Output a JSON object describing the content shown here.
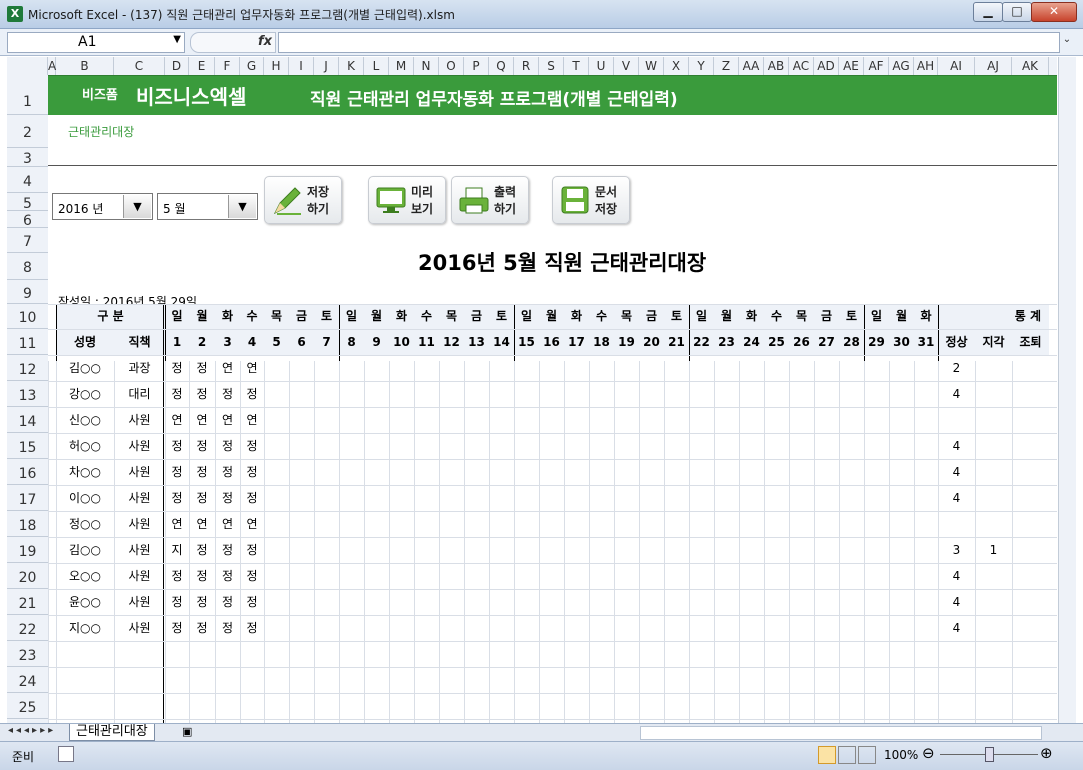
{
  "window": {
    "title": "Microsoft Excel - (137) 직원 근태관리 업무자동화 프로그램(개별 근태입력).xlsm",
    "app_icon": "X",
    "min": "▁",
    "max": "□",
    "close": "✕"
  },
  "formula": {
    "namebox": "A1",
    "fx": "fx",
    "value": ""
  },
  "columns": [
    "A",
    "B",
    "C",
    "D",
    "E",
    "F",
    "G",
    "H",
    "I",
    "J",
    "K",
    "L",
    "M",
    "N",
    "O",
    "P",
    "Q",
    "R",
    "S",
    "T",
    "U",
    "V",
    "W",
    "X",
    "Y",
    "Z",
    "AA",
    "AB",
    "AC",
    "AD",
    "AE",
    "AF",
    "AG",
    "AH",
    "AI",
    "AJ",
    "AK"
  ],
  "rows": [
    "1",
    "2",
    "3",
    "4",
    "5",
    "6",
    "7",
    "8",
    "9",
    "10",
    "11",
    "12",
    "13",
    "14",
    "15",
    "16",
    "17",
    "18",
    "19",
    "20",
    "21",
    "22",
    "23",
    "24",
    "25"
  ],
  "banner": {
    "brand_small": "비즈폼",
    "brand_big": "비즈니스엑셀",
    "title": "직원 근태관리 업무자동화 프로그램(개별 근태입력)"
  },
  "subtab": "근태관리대장",
  "controls": {
    "year": "2016 년",
    "month": "5 월",
    "save": [
      "저장",
      "하기"
    ],
    "preview": [
      "미리",
      "보기"
    ],
    "print": [
      "출력",
      "하기"
    ],
    "docsave": [
      "문서",
      "저장"
    ]
  },
  "report": {
    "title": "2016년 5월 직원 근태관리대장",
    "created": "작성일 :  2016년 5월 29일"
  },
  "table": {
    "hdr_group": "구 분",
    "hdr_name": "성명",
    "hdr_role": "직책",
    "hdr_stats": "통 계",
    "weekdays": [
      "일",
      "월",
      "화",
      "수",
      "목",
      "금",
      "토",
      "일",
      "월",
      "화",
      "수",
      "목",
      "금",
      "토",
      "일",
      "월",
      "화",
      "수",
      "목",
      "금",
      "토",
      "일",
      "월",
      "화",
      "수",
      "목",
      "금",
      "토",
      "일",
      "월",
      "화"
    ],
    "days": [
      "1",
      "2",
      "3",
      "4",
      "5",
      "6",
      "7",
      "8",
      "9",
      "10",
      "11",
      "12",
      "13",
      "14",
      "15",
      "16",
      "17",
      "18",
      "19",
      "20",
      "21",
      "22",
      "23",
      "24",
      "25",
      "26",
      "27",
      "28",
      "29",
      "30",
      "31"
    ],
    "stats": [
      "정상",
      "지각",
      "조퇴"
    ],
    "employees": [
      {
        "name": "김○○",
        "role": "과장",
        "att": [
          "정",
          "정",
          "연",
          "연"
        ],
        "normal": "2",
        "late": ""
      },
      {
        "name": "강○○",
        "role": "대리",
        "att": [
          "정",
          "정",
          "정",
          "정"
        ],
        "normal": "4",
        "late": ""
      },
      {
        "name": "신○○",
        "role": "사원",
        "att": [
          "연",
          "연",
          "연",
          "연"
        ],
        "normal": "",
        "late": ""
      },
      {
        "name": "허○○",
        "role": "사원",
        "att": [
          "정",
          "정",
          "정",
          "정"
        ],
        "normal": "4",
        "late": ""
      },
      {
        "name": "차○○",
        "role": "사원",
        "att": [
          "정",
          "정",
          "정",
          "정"
        ],
        "normal": "4",
        "late": ""
      },
      {
        "name": "이○○",
        "role": "사원",
        "att": [
          "정",
          "정",
          "정",
          "정"
        ],
        "normal": "4",
        "late": ""
      },
      {
        "name": "정○○",
        "role": "사원",
        "att": [
          "연",
          "연",
          "연",
          "연"
        ],
        "normal": "",
        "late": ""
      },
      {
        "name": "김○○",
        "role": "사원",
        "att": [
          "지",
          "정",
          "정",
          "정"
        ],
        "normal": "3",
        "late": "1"
      },
      {
        "name": "오○○",
        "role": "사원",
        "att": [
          "정",
          "정",
          "정",
          "정"
        ],
        "normal": "4",
        "late": ""
      },
      {
        "name": "윤○○",
        "role": "사원",
        "att": [
          "정",
          "정",
          "정",
          "정"
        ],
        "normal": "4",
        "late": ""
      },
      {
        "name": "지○○",
        "role": "사원",
        "att": [
          "정",
          "정",
          "정",
          "정"
        ],
        "normal": "4",
        "late": ""
      }
    ]
  },
  "sheet_tab": "근태관리대장",
  "status": {
    "ready": "준비",
    "zoom": "100%",
    "zoom_out": "⊖",
    "zoom_in": "⊕"
  },
  "colors": {
    "banner": "#3a9b3c",
    "accent_text": "#3a9b3c"
  }
}
